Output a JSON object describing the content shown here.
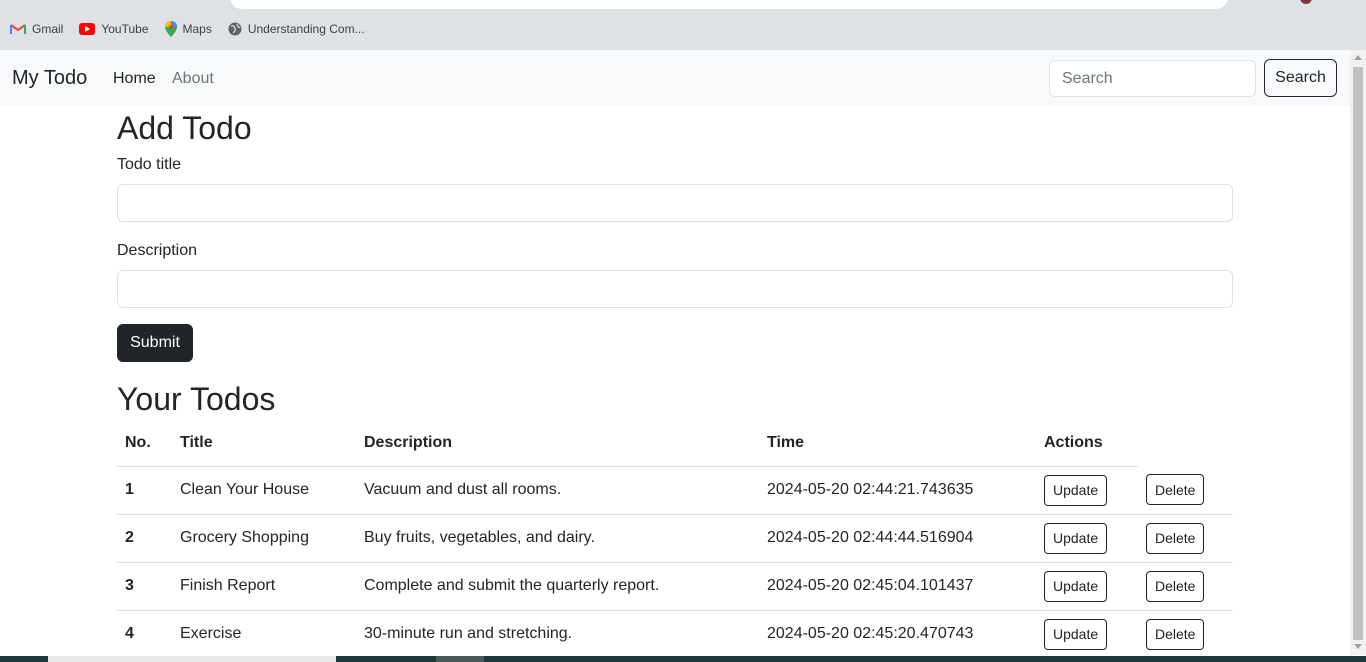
{
  "browser": {
    "bookmarks": [
      {
        "label": "Gmail",
        "icon": "gmail-icon"
      },
      {
        "label": "YouTube",
        "icon": "youtube-icon"
      },
      {
        "label": "Maps",
        "icon": "maps-icon"
      },
      {
        "label": "Understanding Com...",
        "icon": "globe-icon"
      }
    ]
  },
  "navbar": {
    "brand": "My Todo",
    "links": [
      "Home",
      "About"
    ],
    "search_placeholder": "Search",
    "search_button": "Search"
  },
  "form": {
    "heading": "Add Todo",
    "title_label": "Todo title",
    "title_value": "",
    "description_label": "Description",
    "description_value": "",
    "submit_label": "Submit"
  },
  "todos": {
    "heading": "Your Todos",
    "columns": [
      "No.",
      "Title",
      "Description",
      "Time",
      "Actions"
    ],
    "update_label": "Update",
    "delete_label": "Delete",
    "rows": [
      {
        "no": "1",
        "title": "Clean Your House",
        "description": "Vacuum and dust all rooms.",
        "time": "2024-05-20 02:44:21.743635"
      },
      {
        "no": "2",
        "title": "Grocery Shopping",
        "description": "Buy fruits, vegetables, and dairy.",
        "time": "2024-05-20 02:44:44.516904"
      },
      {
        "no": "3",
        "title": "Finish Report",
        "description": "Complete and submit the quarterly report.",
        "time": "2024-05-20 02:45:04.101437"
      },
      {
        "no": "4",
        "title": "Exercise",
        "description": "30-minute run and stretching.",
        "time": "2024-05-20 02:45:20.470743"
      }
    ]
  },
  "colors": {
    "navbar_bg": "#f8f9fa",
    "primary_dark": "#212529",
    "muted_text": "#6c757d",
    "chrome_bg": "#dee1e6"
  }
}
